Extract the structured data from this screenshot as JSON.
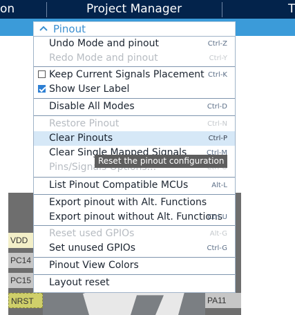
{
  "topbar": {
    "tab_left": "on",
    "tab_center": "Project Manager",
    "tab_right": "T"
  },
  "dropdown": {
    "title": "Pinout",
    "items": [
      {
        "label": "Undo Mode and pinout",
        "shortcut": "Ctrl-Z",
        "enabled": true
      },
      {
        "label": "Redo Mode and pinout",
        "shortcut": "Ctrl-Y",
        "enabled": false
      },
      {
        "label": "Keep Current Signals Placement",
        "shortcut": "Ctrl-K",
        "enabled": true,
        "checked": false
      },
      {
        "label": "Show User Label",
        "shortcut": "",
        "enabled": true,
        "checked": true
      },
      {
        "label": "Disable All Modes",
        "shortcut": "Ctrl-D",
        "enabled": true
      },
      {
        "label": "Restore Pinout",
        "shortcut": "Ctrl-N",
        "enabled": false
      },
      {
        "label": "Clear Pinouts",
        "shortcut": "Ctrl-P",
        "enabled": true,
        "highlighted": true
      },
      {
        "label": "Clear Single Mapped Signals",
        "shortcut": "Ctrl-M",
        "enabled": true
      },
      {
        "label": "Pins/Signals Options...",
        "shortcut": "Ctrl-O",
        "enabled": false
      },
      {
        "label": "List Pinout Compatible MCUs",
        "shortcut": "Alt-L",
        "enabled": true
      },
      {
        "label": "Export pinout with Alt. Functions",
        "shortcut": "",
        "enabled": true
      },
      {
        "label": "Export pinout without Alt. Functions",
        "shortcut": "Ctrl-U",
        "enabled": true
      },
      {
        "label": "Reset used GPIOs",
        "shortcut": "Alt-G",
        "enabled": false
      },
      {
        "label": "Set unused GPIOs",
        "shortcut": "Ctrl-G",
        "enabled": true
      },
      {
        "label": "Pinout View Colors",
        "shortcut": "",
        "enabled": true
      },
      {
        "label": "Layout reset",
        "shortcut": "",
        "enabled": true
      }
    ]
  },
  "tooltip": "Reset the pinout configuration",
  "chip": {
    "left_pins": [
      "VDD",
      "PC14",
      "PC15",
      "NRST"
    ],
    "right_pins": [
      "PA11"
    ]
  },
  "colors": {
    "header_dark": "#03234b",
    "header_blue": "#3b9bd9",
    "accent": "#3b8fd0",
    "highlight": "#d6e8f7"
  }
}
